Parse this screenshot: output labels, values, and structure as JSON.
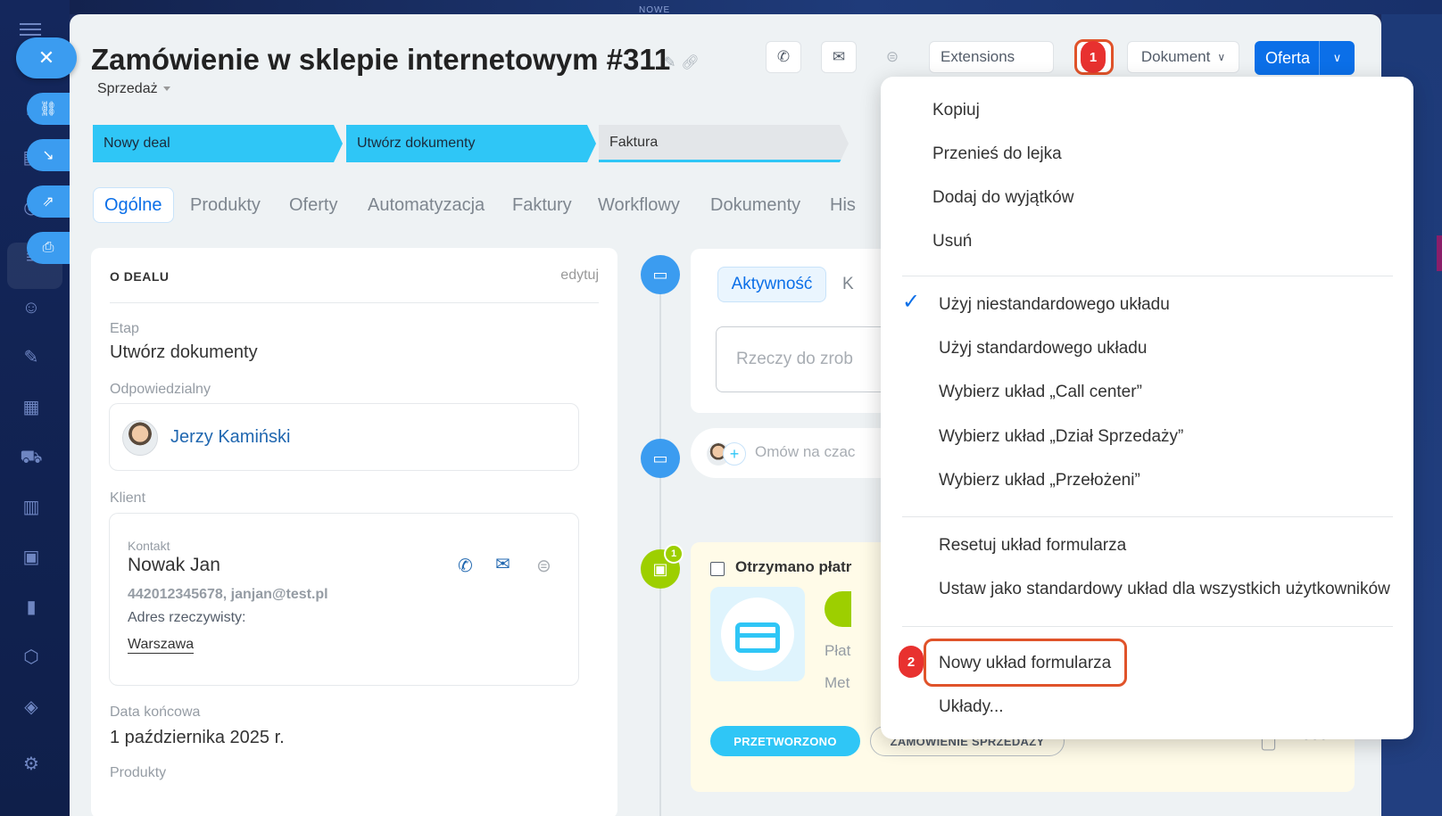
{
  "top_strip": {
    "label": "NOWE"
  },
  "header": {
    "title": "Zamówienie w sklepie internetowym #311",
    "category": "Sprzedaż",
    "extensions_label": "Extensions",
    "document_label": "Dokument",
    "offer_label": "Oferta"
  },
  "badges": {
    "step1": "1",
    "step2": "2",
    "activity_count": "1"
  },
  "pipeline": [
    {
      "label": "Nowy deal",
      "state": "done"
    },
    {
      "label": "Utwórz dokumenty",
      "state": "done"
    },
    {
      "label": "Faktura",
      "state": "todo"
    }
  ],
  "tabs": [
    "Ogólne",
    "Produkty",
    "Oferty",
    "Automatyzacja",
    "Faktury",
    "Workflowy",
    "Dokumenty",
    "His"
  ],
  "deal_card": {
    "heading": "O DEALU",
    "edit": "edytuj",
    "stage_label": "Etap",
    "stage_value": "Utwórz dokumenty",
    "responsible_label": "Odpowiedzialny",
    "responsible_name": "Jerzy Kamiński",
    "client_label": "Klient",
    "contact_label": "Kontakt",
    "contact_name": "Nowak Jan",
    "contact_details": "442012345678, janjan@test.pl",
    "address_label": "Adres rzeczywisty:",
    "address_city": "Warszawa",
    "end_date_label": "Data końcowa",
    "end_date_value": "1 października 2025 r.",
    "products_label": "Produkty"
  },
  "timeline": {
    "activity_tab": "Aktywność",
    "second_tab_partial": "K",
    "todo_placeholder": "Rzeczy do zrob",
    "comment_placeholder": "Omów na czac",
    "payment_title": "Otrzymano płatr",
    "payment_line1": "Płat",
    "payment_line2": "Met",
    "pill_processed": "PRZETWORZONO",
    "pill_order": "ZAMÓWIENIE SPRZEDAŻY"
  },
  "menu": {
    "group1": [
      "Kopiuj",
      "Przenieś do lejka",
      "Dodaj do wyjątków",
      "Usuń"
    ],
    "group2": [
      "Użyj niestandardowego układu",
      "Użyj standardowego układu",
      "Wybierz układ „Call center”",
      "Wybierz układ „Dział Sprzedaży”",
      "Wybierz układ „Przełożeni”"
    ],
    "group3": [
      "Resetuj układ formularza",
      "Ustaw jako standardowy układ dla wszystkich użytkowników"
    ],
    "group4": [
      "Nowy układ formularza",
      "Układy..."
    ]
  },
  "colors": {
    "accent": "#0b6fe8",
    "stage": "#2fc6f6",
    "highlight": "#e0532a",
    "badge": "#e8312f"
  }
}
